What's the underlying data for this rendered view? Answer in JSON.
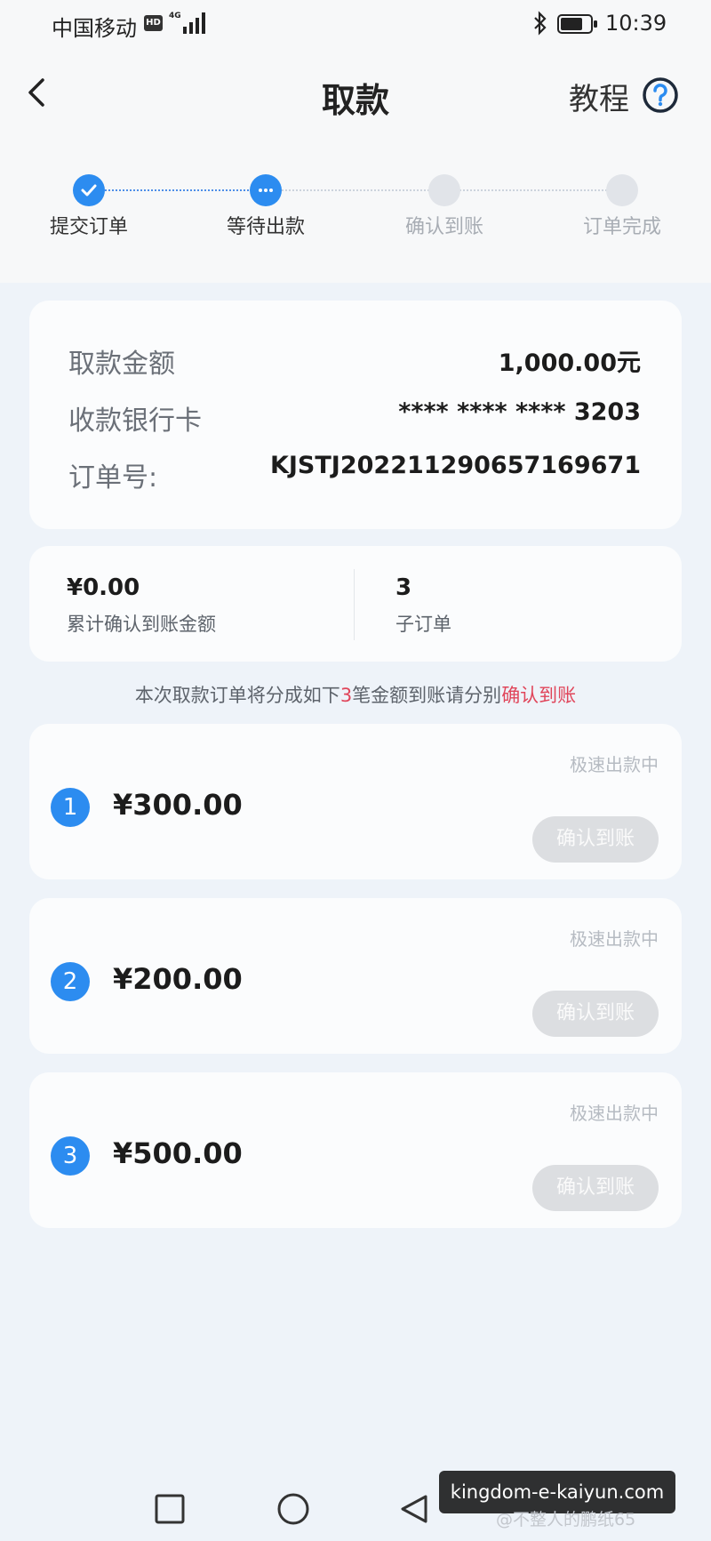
{
  "status_bar": {
    "carrier": "中国移动",
    "hd": "HD",
    "network": "4G",
    "time": "10:39",
    "icons": [
      "signal-icon",
      "bluetooth-icon",
      "battery-icon"
    ]
  },
  "header": {
    "title": "取款",
    "tutorial_label": "教程",
    "icons": [
      "back-arrow-icon",
      "help-icon"
    ]
  },
  "steps": [
    {
      "label": "提交订单",
      "state": "done",
      "icon": "check-icon"
    },
    {
      "label": "等待出款",
      "state": "current",
      "icon": "ellipsis-icon"
    },
    {
      "label": "确认到账",
      "state": "pending"
    },
    {
      "label": "订单完成",
      "state": "pending"
    }
  ],
  "order": {
    "amount_label": "取款金额",
    "amount_value": "1,000.00元",
    "card_label": "收款银行卡",
    "card_value": "**** **** **** 3203",
    "order_no_label": "订单号:",
    "order_no_value": "KJSTJ2022112906571696​71"
  },
  "summary": {
    "confirmed_value": "¥0.00",
    "confirmed_label": "累计确认到账金额",
    "sub_count_value": "3",
    "sub_count_label": "子订单"
  },
  "notice": {
    "prefix": "本次取款订单将分成如下",
    "count": "3",
    "middle": "笔金额到账请分别",
    "link": "确认到账"
  },
  "sub_orders": [
    {
      "index": "1",
      "amount": "¥300.00",
      "status": "极速出款中",
      "button": "确认到账"
    },
    {
      "index": "2",
      "amount": "¥200.00",
      "status": "极速出款中",
      "button": "确认到账"
    },
    {
      "index": "3",
      "amount": "¥500.00",
      "status": "极速出款中",
      "button": "确认到账"
    }
  ],
  "overlay": {
    "watermark": "kingdom-e-kaiyun.com",
    "credit": "@不整人的鹏纸65"
  },
  "nav_bar": {
    "icons": [
      "recent-apps-icon",
      "home-icon",
      "back-icon"
    ]
  },
  "colors": {
    "accent": "#2c8cf0",
    "highlight": "#e0455a",
    "disabled_button": "#dcdee1"
  }
}
